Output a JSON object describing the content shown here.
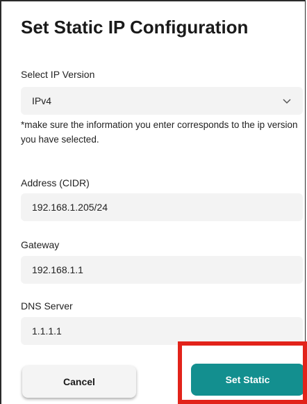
{
  "dialog": {
    "title": "Set Static IP Configuration"
  },
  "ip_version": {
    "label": "Select IP Version",
    "selected": "IPv4",
    "icon": "chevron-down-icon"
  },
  "note": "*make sure the information you enter corresponds to the ip version you have selected.",
  "address": {
    "label": "Address (CIDR)",
    "value": "192.168.1.205/24"
  },
  "gateway": {
    "label": "Gateway",
    "value": "192.168.1.1"
  },
  "dns": {
    "label": "DNS Server",
    "value": "1.1.1.1"
  },
  "buttons": {
    "cancel": "Cancel",
    "set_static": "Set Static"
  },
  "colors": {
    "primary": "#138f8f",
    "highlight": "#e2231a",
    "field_bg": "#f3f3f3"
  }
}
